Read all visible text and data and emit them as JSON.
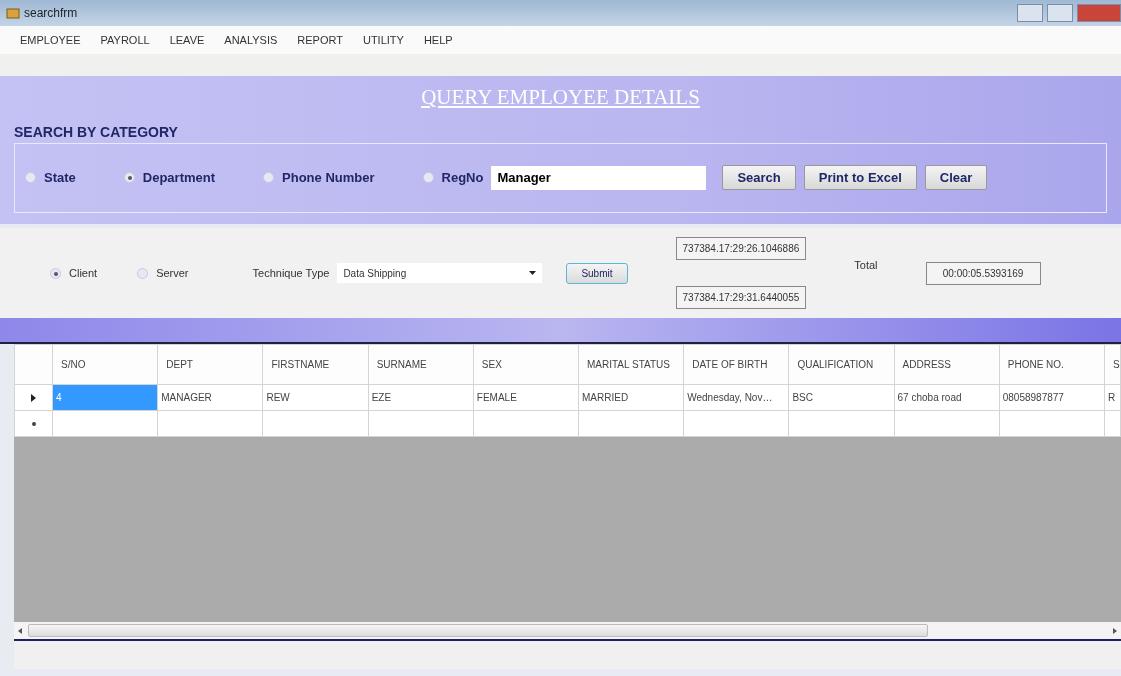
{
  "window": {
    "title": "searchfrm"
  },
  "menu": [
    "EMPLOYEE",
    "PAYROLL",
    "LEAVE",
    "ANALYSIS",
    "REPORT",
    "UTILITY",
    "HELP"
  ],
  "heading": "QUERY EMPLOYEE DETAILS",
  "search_group": {
    "title": "SEARCH BY CATEGORY",
    "options": [
      {
        "label": "State",
        "selected": false
      },
      {
        "label": "Department",
        "selected": true
      },
      {
        "label": "Phone Number",
        "selected": false
      },
      {
        "label": "RegNo",
        "selected": false
      }
    ],
    "query": "Manager",
    "buttons": [
      "Search",
      "Print to Excel",
      "Clear"
    ]
  },
  "mode": [
    {
      "label": "Client",
      "selected": true
    },
    {
      "label": "Server",
      "selected": false
    }
  ],
  "technique": {
    "label": "Technique Type",
    "value": "Data Shipping",
    "button": "Submit"
  },
  "times": {
    "start": "737384.17:29:26.1046886",
    "end": "737384.17:29:31.6440055",
    "total_label": "Total",
    "total": "00:00:05.5393169"
  },
  "table": {
    "columns": [
      "S/NO",
      "DEPT",
      "FIRSTNAME",
      "SURNAME",
      "SEX",
      "MARITAL STATUS",
      "DATE OF BIRTH",
      "QUALIFICATION",
      "ADDRESS",
      "PHONE NO.",
      "S"
    ],
    "rows": [
      {
        "kind": "current",
        "cells": [
          {
            "text": "4",
            "selected": true
          },
          {
            "text": "MANAGER",
            "selected": false
          },
          {
            "text": "REW",
            "selected": false
          },
          {
            "text": "EZE",
            "selected": false
          },
          {
            "text": "FEMALE",
            "selected": false
          },
          {
            "text": "MARRIED",
            "selected": false
          },
          {
            "text": "Wednesday, Nov…",
            "selected": false
          },
          {
            "text": "BSC",
            "selected": false
          },
          {
            "text": "67 choba road",
            "selected": false
          },
          {
            "text": "08058987877",
            "selected": false
          },
          {
            "text": "R",
            "selected": false
          }
        ]
      },
      {
        "kind": "new"
      }
    ]
  }
}
